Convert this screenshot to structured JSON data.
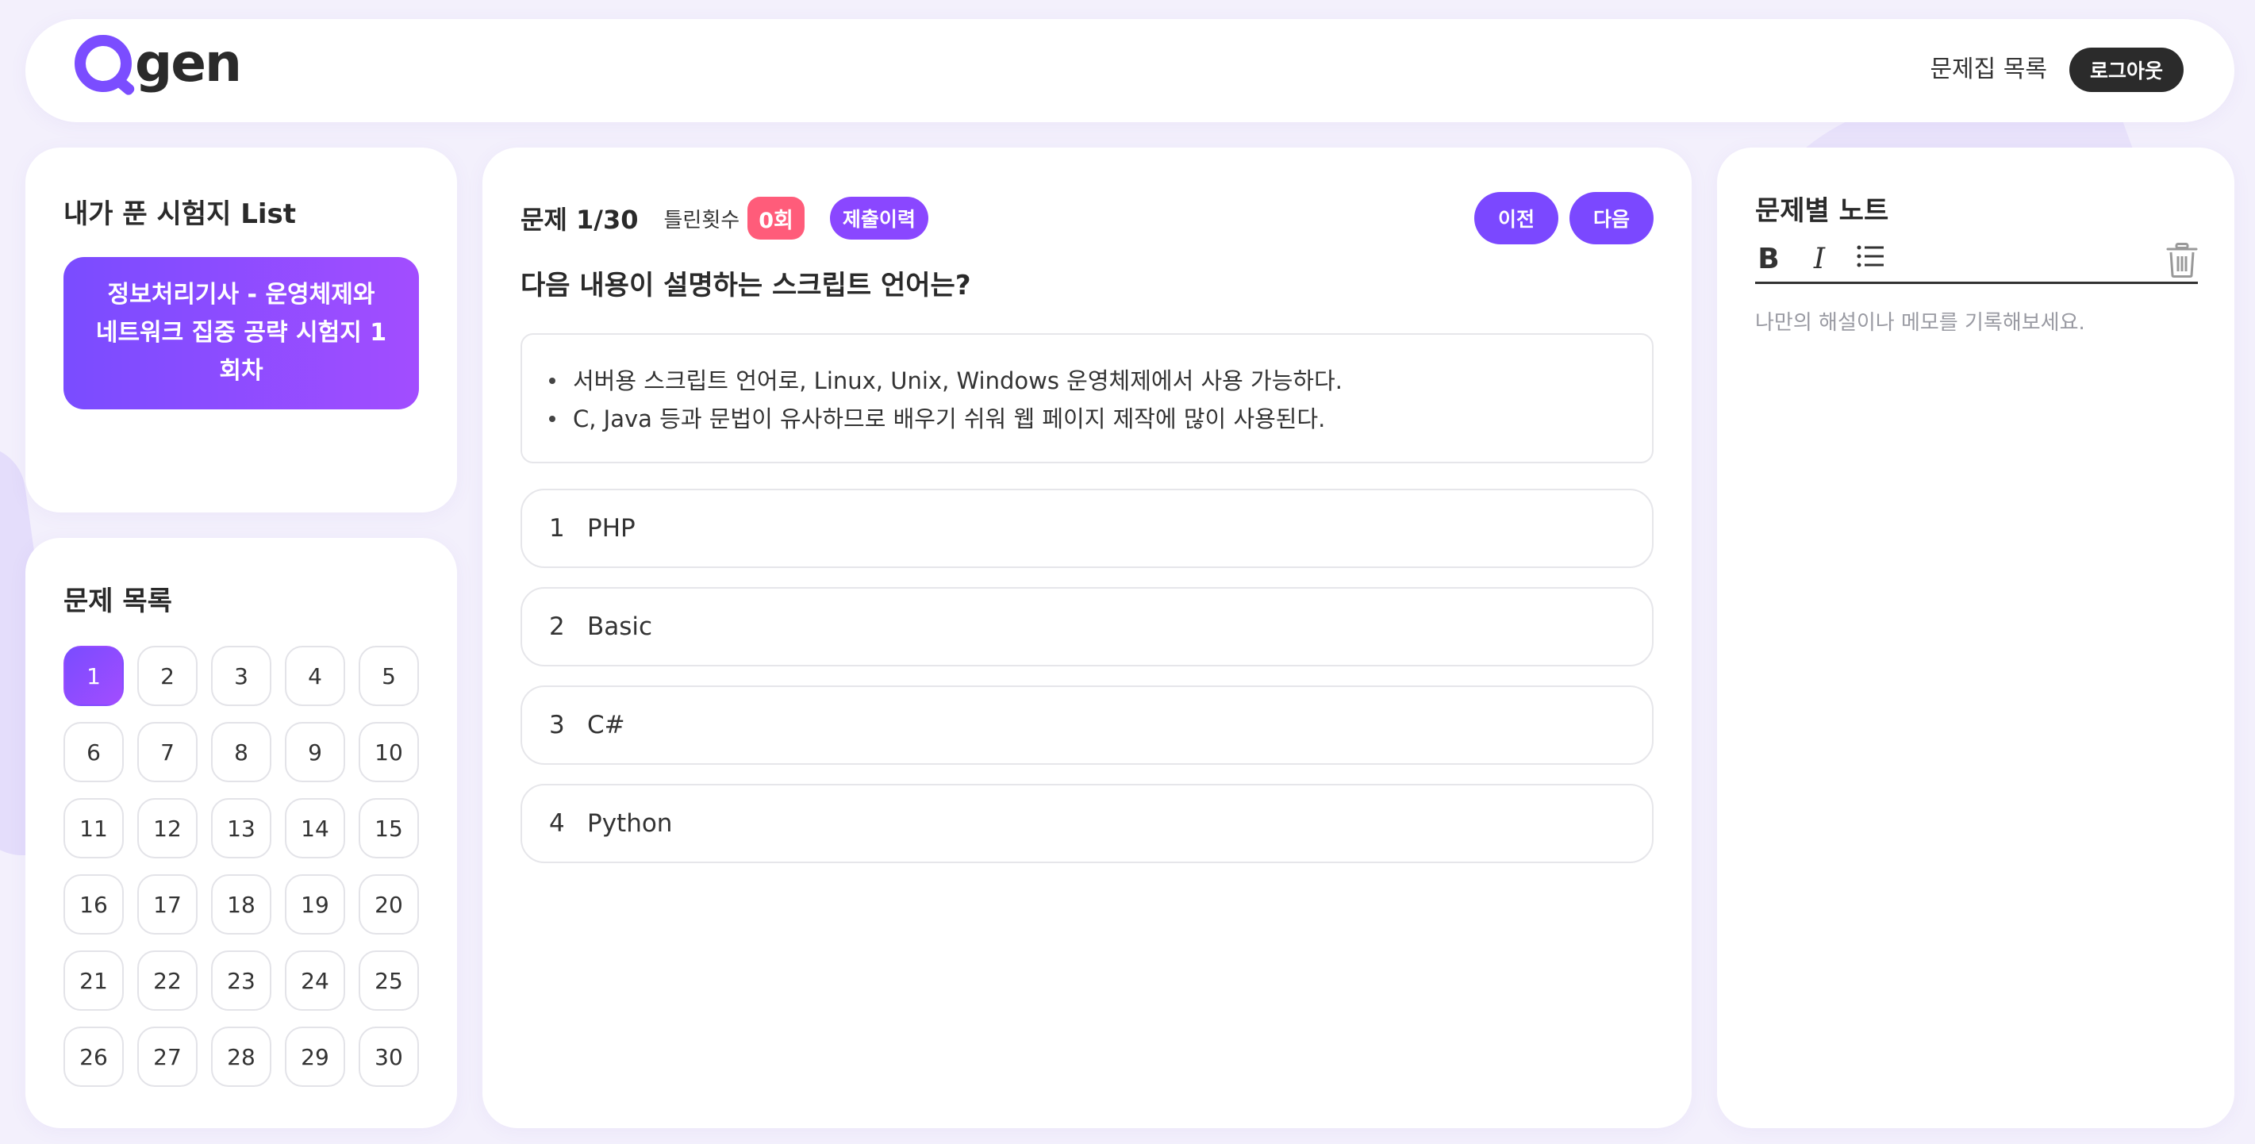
{
  "header": {
    "logo_text": "gen",
    "nav_link": "문제집 목록",
    "logout": "로그아웃"
  },
  "exam_list": {
    "title": "내가 푼 시험지 List",
    "items": [
      "정보처리기사 - 운영체제와 네트워크 집중 공략 시험지 1회차"
    ]
  },
  "question_list": {
    "title": "문제 목록",
    "numbers": [
      "1",
      "2",
      "3",
      "4",
      "5",
      "6",
      "7",
      "8",
      "9",
      "10",
      "11",
      "12",
      "13",
      "14",
      "15",
      "16",
      "17",
      "18",
      "19",
      "20",
      "21",
      "22",
      "23",
      "24",
      "25",
      "26",
      "27",
      "28",
      "29",
      "30"
    ],
    "active": 1
  },
  "question": {
    "number_label": "문제 1/30",
    "wrong_label": "틀린횟수",
    "wrong_count": "0회",
    "history_label": "제출이력",
    "prev": "이전",
    "next": "다음",
    "text": "다음 내용이 설명하는 스크립트 언어는?",
    "description": [
      "서버용 스크립트 언어로, Linux, Unix, Windows 운영체제에서 사용 가능하다.",
      "C, Java 등과 문법이 유사하므로 배우기 쉬워 웹 페이지 제작에 많이 사용된다."
    ],
    "choices": [
      {
        "num": "1",
        "text": "PHP"
      },
      {
        "num": "2",
        "text": "Basic"
      },
      {
        "num": "3",
        "text": "C#"
      },
      {
        "num": "4",
        "text": "Python"
      }
    ]
  },
  "notes": {
    "title": "문제별 노트",
    "bold": "B",
    "italic": "I",
    "placeholder": "나만의 해설이나 메모를 기록해보세요."
  },
  "colors": {
    "accent": "#7b48ff",
    "wrong_badge": "#ff5c7a",
    "logout_bg": "#2b2b2b"
  },
  "icons": [
    "bold-icon",
    "italic-icon",
    "list-icon",
    "trash-icon"
  ]
}
